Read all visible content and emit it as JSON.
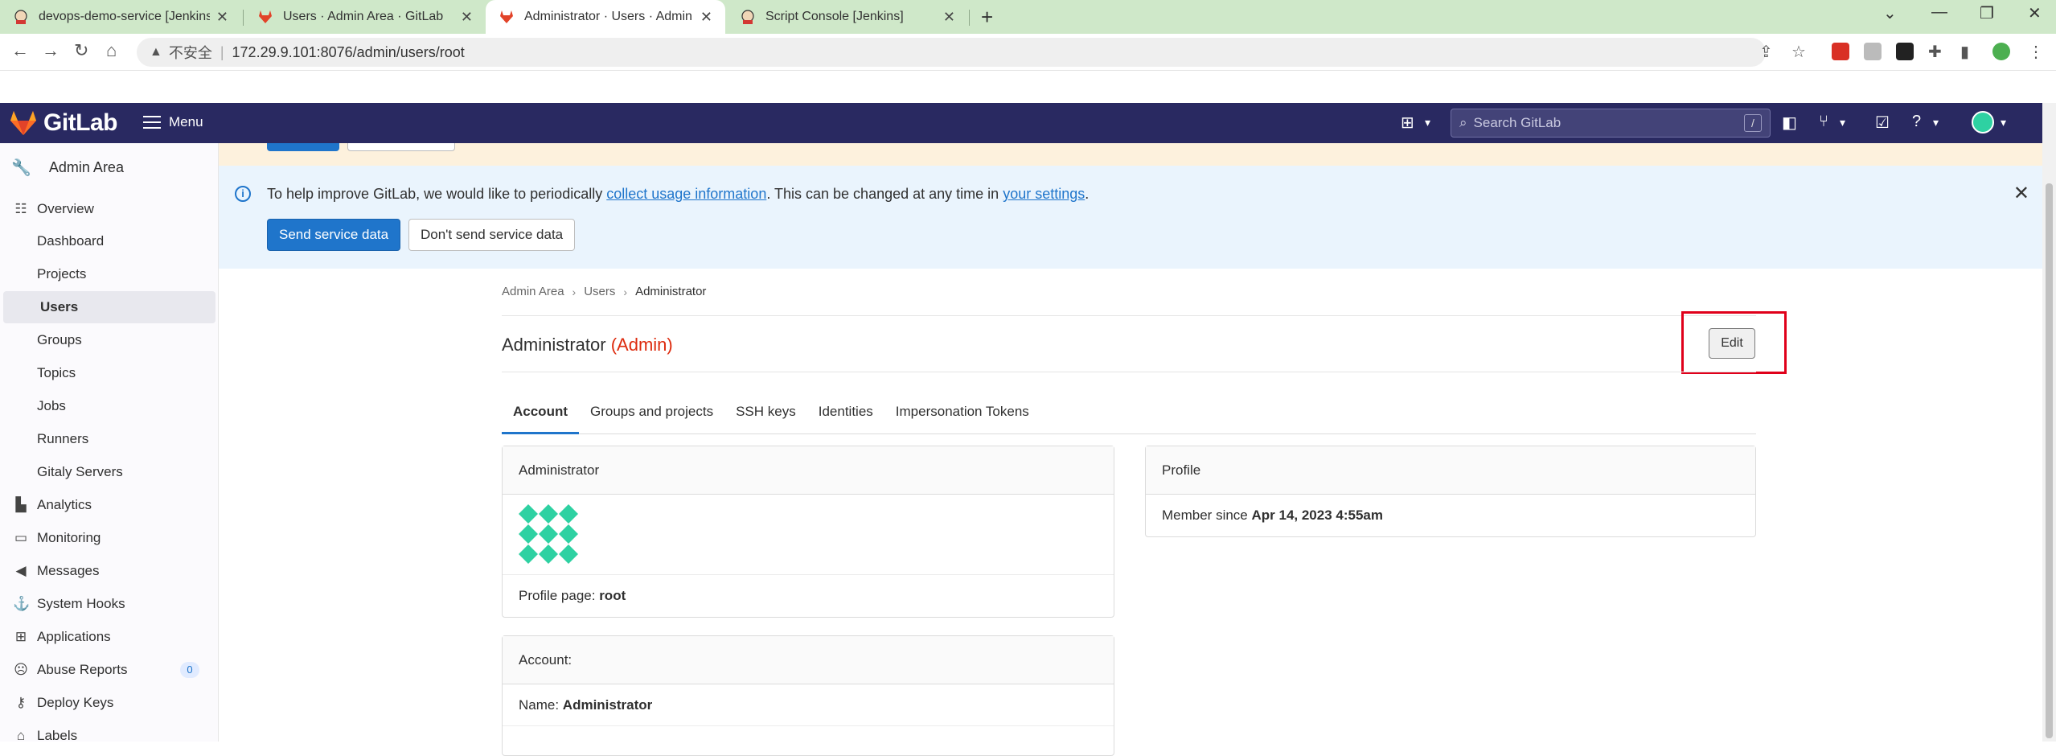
{
  "browser": {
    "tabs": [
      {
        "title": "devops-demo-service [Jenkins]",
        "active": false
      },
      {
        "title": "Users · Admin Area · GitLab",
        "active": false
      },
      {
        "title": "Administrator · Users · Admin Area",
        "active": true
      },
      {
        "title": "Script Console [Jenkins]",
        "active": false
      }
    ],
    "security_label": "不安全",
    "url": "172.29.9.101:8076/admin/users/root"
  },
  "header": {
    "logo_text": "GitLab",
    "menu_label": "Menu",
    "search_placeholder": "Search GitLab",
    "search_shortcut": "/"
  },
  "sidebar": {
    "title": "Admin Area",
    "items": [
      {
        "label": "Overview",
        "icon": "overview-icon",
        "level": 0
      },
      {
        "label": "Dashboard",
        "level": 1
      },
      {
        "label": "Projects",
        "level": 1
      },
      {
        "label": "Users",
        "level": 1,
        "active": true
      },
      {
        "label": "Groups",
        "level": 1
      },
      {
        "label": "Topics",
        "level": 1
      },
      {
        "label": "Jobs",
        "level": 1
      },
      {
        "label": "Runners",
        "level": 1
      },
      {
        "label": "Gitaly Servers",
        "level": 1
      },
      {
        "label": "Analytics",
        "icon": "chart-icon",
        "level": 0
      },
      {
        "label": "Monitoring",
        "icon": "monitor-icon",
        "level": 0
      },
      {
        "label": "Messages",
        "icon": "bullhorn-icon",
        "level": 0
      },
      {
        "label": "System Hooks",
        "icon": "hook-icon",
        "level": 0
      },
      {
        "label": "Applications",
        "icon": "grid-icon",
        "level": 0
      },
      {
        "label": "Abuse Reports",
        "icon": "abuse-icon",
        "level": 0,
        "badge": "0"
      },
      {
        "label": "Deploy Keys",
        "icon": "key-icon",
        "level": 0
      },
      {
        "label": "Labels",
        "icon": "label-icon",
        "level": 0
      }
    ]
  },
  "alert": {
    "text_before": "To help improve GitLab, we would like to periodically ",
    "link1": "collect usage information",
    "text_middle": ". This can be changed at any time in ",
    "link2": "your settings",
    "text_after": ".",
    "primary_button": "Send service data",
    "secondary_button": "Don't send service data"
  },
  "breadcrumb": [
    "Admin Area",
    "Users",
    "Administrator"
  ],
  "page": {
    "title": "Administrator",
    "admin_tag": "(Admin)",
    "edit_button": "Edit"
  },
  "tabs": [
    "Account",
    "Groups and projects",
    "SSH keys",
    "Identities",
    "Impersonation Tokens"
  ],
  "user_card": {
    "header": "Administrator",
    "profile_page_label": "Profile page: ",
    "profile_page_value": "root"
  },
  "profile_card": {
    "header": "Profile",
    "member_since_label": "Member since ",
    "member_since_value": "Apr 14, 2023 4:55am"
  },
  "account_card": {
    "header": "Account:",
    "name_label": "Name: ",
    "name_value": "Administrator"
  },
  "colors": {
    "header_bg": "#292961",
    "primary": "#1f75cb",
    "admin_red": "#dd2b0e",
    "highlight_box": "#e0001a",
    "tabbar_bg": "#cfe8c9"
  }
}
